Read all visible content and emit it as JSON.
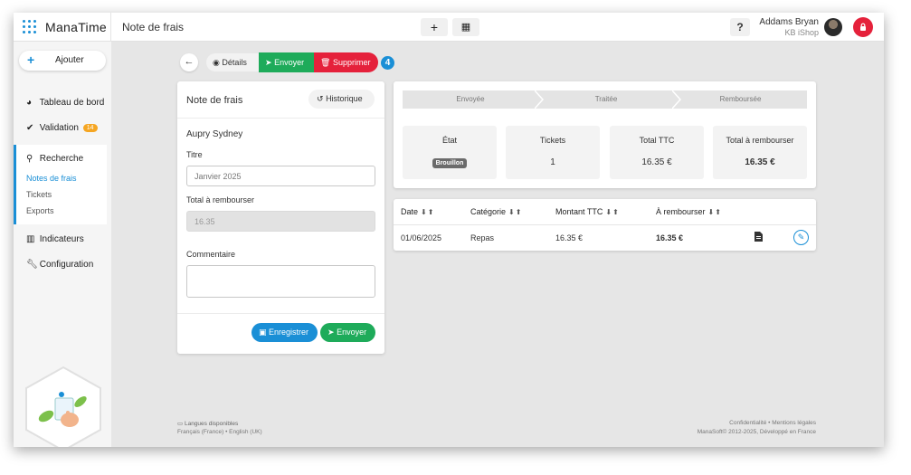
{
  "header": {
    "logo": "ManaTime",
    "page_title": "Note de frais",
    "plus_icon": "+",
    "calendar_icon": "▦",
    "help": "?",
    "user_name": "Addams Bryan",
    "user_org": "KB iShop"
  },
  "sidebar": {
    "add_label": "Ajouter",
    "items": [
      {
        "label": "Tableau de bord",
        "icon": "pie-chart-icon"
      },
      {
        "label": "Validation",
        "badge": "14",
        "icon": "check-icon"
      },
      {
        "label": "Recherche",
        "icon": "search-icon"
      },
      {
        "label": "Indicateurs",
        "icon": "bar-chart-icon"
      },
      {
        "label": "Configuration",
        "icon": "wrench-icon"
      }
    ],
    "search_sub": [
      "Notes de frais",
      "Tickets",
      "Exports"
    ]
  },
  "actions": {
    "details": "Détails",
    "send": "Envoyer",
    "delete": "Supprimer",
    "step_count": "4"
  },
  "form": {
    "title": "Note de frais",
    "history": "Historique",
    "person": "Aupry Sydney",
    "titre_label": "Titre",
    "titre_value": "Janvier 2025",
    "total_label": "Total à rembourser",
    "total_value": "16.35",
    "comment_label": "Commentaire",
    "save": "Enregistrer",
    "send": "Envoyer"
  },
  "status": {
    "steps": [
      "Envoyée",
      "Traitée",
      "Remboursée"
    ],
    "cards": [
      {
        "label": "État",
        "value": "Brouillon"
      },
      {
        "label": "Tickets",
        "value": "1"
      },
      {
        "label": "Total TTC",
        "value": "16.35 €"
      },
      {
        "label": "Total à rembourser",
        "value": "16.35 €"
      }
    ]
  },
  "table": {
    "headers": [
      "Date",
      "Catégorie",
      "Montant TTC",
      "À rembourser"
    ],
    "rows": [
      {
        "date": "01/06/2025",
        "category": "Repas",
        "amount": "16.35 €",
        "refund": "16.35 €"
      }
    ]
  },
  "footer": {
    "languages_title": "Langues disponibles",
    "languages": "Français (France) • English (UK)",
    "legal": "Confidentialité • Mentions légales",
    "copyright": "ManaSoft© 2012-2025, Développé en France"
  },
  "colors": {
    "accent": "#1a8fd6",
    "success": "#1eab5a",
    "danger": "#e5213b",
    "badge": "#f5a623"
  }
}
